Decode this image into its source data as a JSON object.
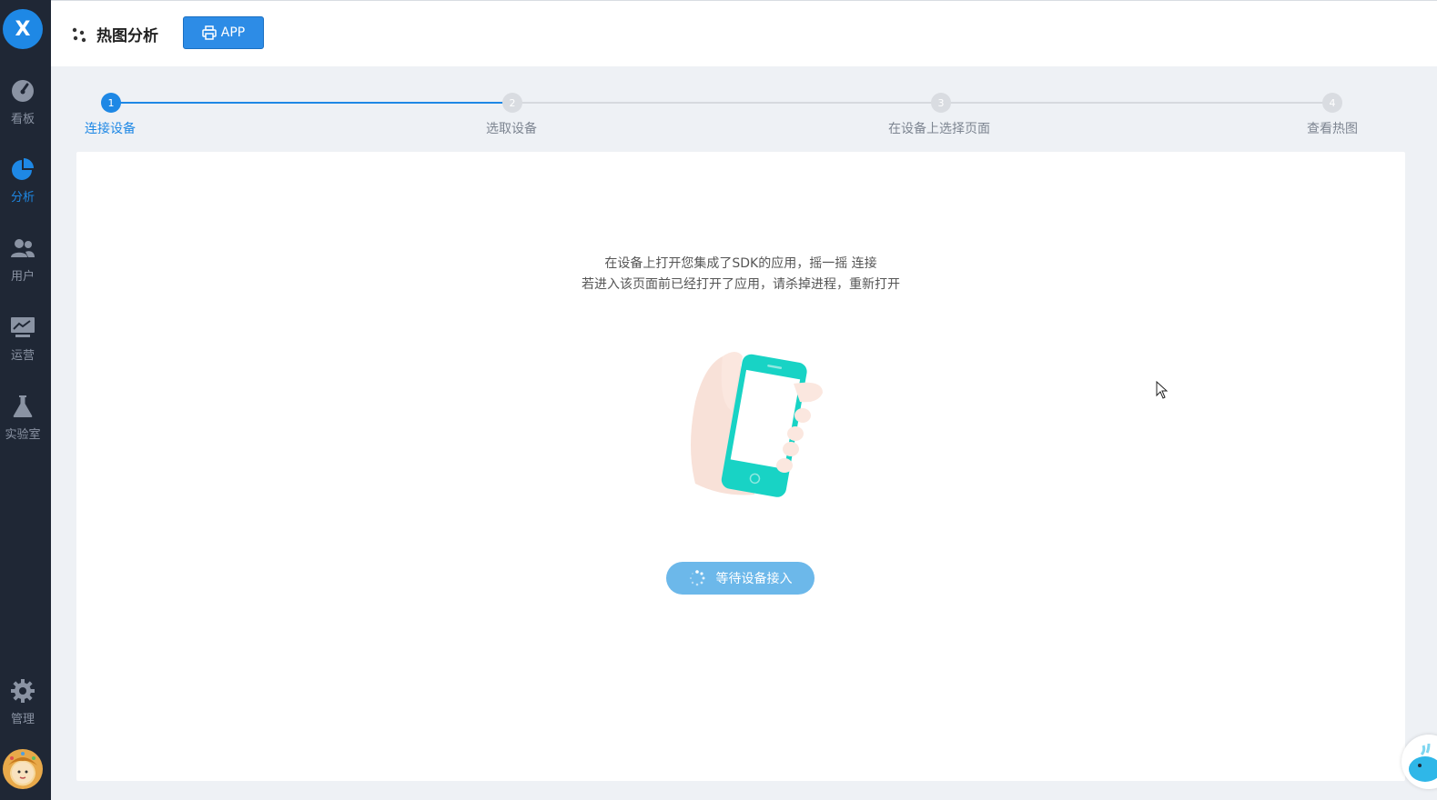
{
  "sidebar": {
    "logo": "X",
    "items": [
      {
        "label": "看板",
        "icon": "dashboard-gauge-icon",
        "active": false
      },
      {
        "label": "分析",
        "icon": "pie-chart-icon",
        "active": true
      },
      {
        "label": "用户",
        "icon": "users-icon",
        "active": false
      },
      {
        "label": "运营",
        "icon": "monitor-chart-icon",
        "active": false
      },
      {
        "label": "实验室",
        "icon": "flask-icon",
        "active": false
      }
    ],
    "bottom_items": [
      {
        "label": "管理",
        "icon": "gear-icon"
      }
    ]
  },
  "header": {
    "title": "热图分析",
    "app_button": "APP"
  },
  "steps": [
    {
      "number": "1",
      "label": "连接设备",
      "active": true
    },
    {
      "number": "2",
      "label": "选取设备",
      "active": false
    },
    {
      "number": "3",
      "label": "在设备上选择页面",
      "active": false
    },
    {
      "number": "4",
      "label": "查看热图",
      "active": false
    }
  ],
  "main": {
    "hint_line1": "在设备上打开您集成了SDK的应用，摇一摇 连接",
    "hint_line2": "若进入该页面前已经打开了应用，请杀掉进程，重新打开",
    "wait_button": "等待设备接入"
  },
  "colors": {
    "accent": "#1e88e5",
    "sidebar_bg": "#1f2735",
    "wait_button_bg": "#6cb8ea",
    "phone": "#18d3c5"
  }
}
